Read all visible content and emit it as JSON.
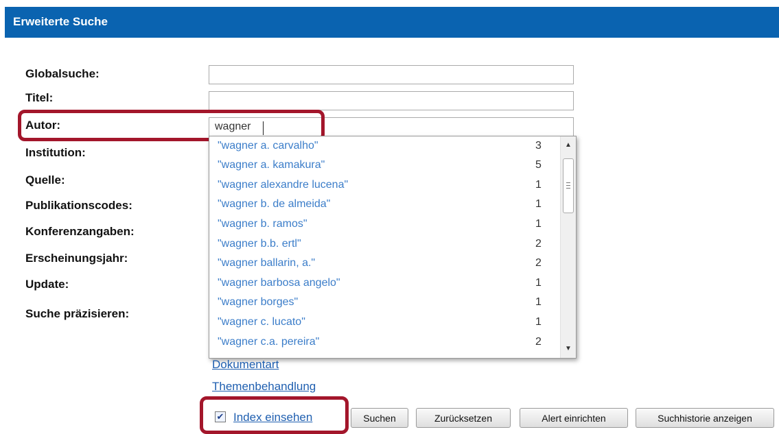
{
  "header": {
    "title": "Erweiterte Suche"
  },
  "form": {
    "labels": {
      "globalsuche": "Globalsuche:",
      "titel": "Titel:",
      "autor": "Autor:",
      "institution": "Institution:",
      "quelle": "Quelle:",
      "publikationscodes": "Publikationscodes:",
      "konferenzangaben": "Konferenzangaben:",
      "erscheinungsjahr": "Erscheinungsjahr:",
      "update": "Update:",
      "suche_praezisieren": "Suche präzisieren:"
    },
    "values": {
      "globalsuche": "",
      "titel": "",
      "autor": "wagner"
    }
  },
  "autocomplete": {
    "items": [
      {
        "text": "\"wagner a. carvalho\"",
        "count": "3"
      },
      {
        "text": "\"wagner a. kamakura\"",
        "count": "5"
      },
      {
        "text": "\"wagner alexandre lucena\"",
        "count": "1"
      },
      {
        "text": "\"wagner b. de almeida\"",
        "count": "1"
      },
      {
        "text": "\"wagner b. ramos\"",
        "count": "1"
      },
      {
        "text": "\"wagner b.b. ertl\"",
        "count": "2"
      },
      {
        "text": "\"wagner ballarin, a.\"",
        "count": "2"
      },
      {
        "text": "\"wagner barbosa angelo\"",
        "count": "1"
      },
      {
        "text": "\"wagner borges\"",
        "count": "1"
      },
      {
        "text": "\"wagner c. lucato\"",
        "count": "1"
      },
      {
        "text": "\"wagner c.a. pereira\"",
        "count": "2"
      }
    ],
    "scroll_up_glyph": "▲",
    "scroll_down_glyph": "▼"
  },
  "links": {
    "dokumentart": "Dokumentart",
    "themenbehandlung": "Themenbehandlung"
  },
  "index": {
    "checked_glyph": "✔",
    "label": "Index einsehen"
  },
  "buttons": {
    "suchen": "Suchen",
    "zuruecksetzen": "Zurücksetzen",
    "alert": "Alert einrichten",
    "historie": "Suchhistorie anzeigen"
  },
  "colors": {
    "header": "#0a63b0",
    "highlight": "#a3162b",
    "link": "#1f5fb0",
    "suggestion": "#3b7dc9"
  }
}
